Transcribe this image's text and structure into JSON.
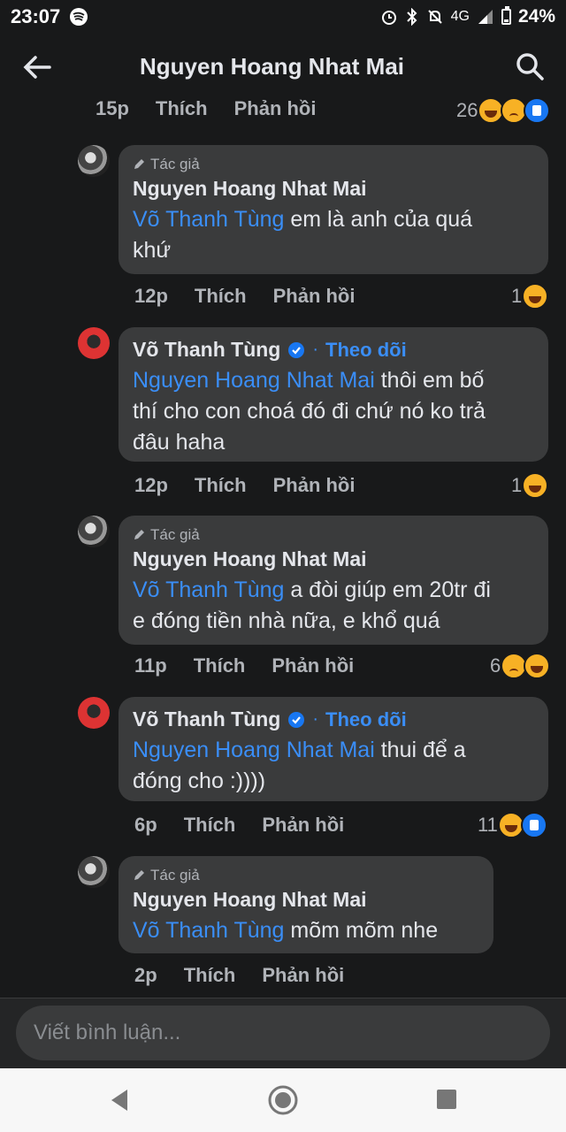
{
  "status_bar": {
    "time": "23:07",
    "network": "4G",
    "battery": "24%"
  },
  "header": {
    "title": "Nguyen Hoang Nhat Mai"
  },
  "top_meta": {
    "time": "15p",
    "like": "Thích",
    "reply": "Phản hồi",
    "reaction_count": "26"
  },
  "comments": [
    {
      "author_badge": "Tác giả",
      "author": "Nguyen Hoang Nhat Mai",
      "mention": "Võ Thanh Tùng",
      "text_line1": " em là anh của quá",
      "text_line2": "khứ",
      "time": "12p",
      "like": "Thích",
      "reply": "Phản hồi",
      "reaction_count": "1"
    },
    {
      "author": "Võ Thanh Tùng",
      "follow_sep": "·",
      "follow": "Theo dõi",
      "mention": "Nguyen Hoang Nhat Mai",
      "text_line1": " thôi em bố",
      "text_line2": "thí cho con choá đó đi chứ nó ko trả",
      "text_line3": "đâu haha",
      "time": "12p",
      "like": "Thích",
      "reply": "Phản hồi",
      "reaction_count": "1"
    },
    {
      "author_badge": "Tác giả",
      "author": "Nguyen Hoang Nhat Mai",
      "mention": "Võ Thanh Tùng",
      "text_line1": " a đòi giúp em 20tr đi",
      "text_line2": "e đóng tiền nhà nữa, e khổ quá",
      "time": "11p",
      "like": "Thích",
      "reply": "Phản hồi",
      "reaction_count": "6"
    },
    {
      "author": "Võ Thanh Tùng",
      "follow_sep": "·",
      "follow": "Theo dõi",
      "mention": "Nguyen Hoang Nhat Mai",
      "text_line1": " thui để a",
      "text_line2": "đóng cho :))))",
      "time": "6p",
      "like": "Thích",
      "reply": "Phản hồi",
      "reaction_count": "11"
    },
    {
      "author_badge": "Tác giả",
      "author": "Nguyen Hoang Nhat Mai",
      "mention": "Võ Thanh Tùng",
      "text_line1": " mõm mõm nhe",
      "time": "2p",
      "like": "Thích",
      "reply": "Phản hồi"
    }
  ],
  "compose": {
    "placeholder": "Viết bình luận..."
  },
  "colors": {
    "background": "#18191a",
    "bubble": "#3a3b3c",
    "link": "#3a8ef7"
  },
  "icons": [
    "spotify-icon",
    "alarm-icon",
    "bluetooth-icon",
    "mute-icon",
    "signal-icon",
    "battery-icon",
    "back-arrow-icon",
    "search-icon",
    "pencil-icon",
    "verified-icon",
    "haha-emoji-icon",
    "sad-emoji-icon",
    "like-emoji-icon",
    "nav-back-icon",
    "nav-home-icon",
    "nav-recent-icon"
  ]
}
